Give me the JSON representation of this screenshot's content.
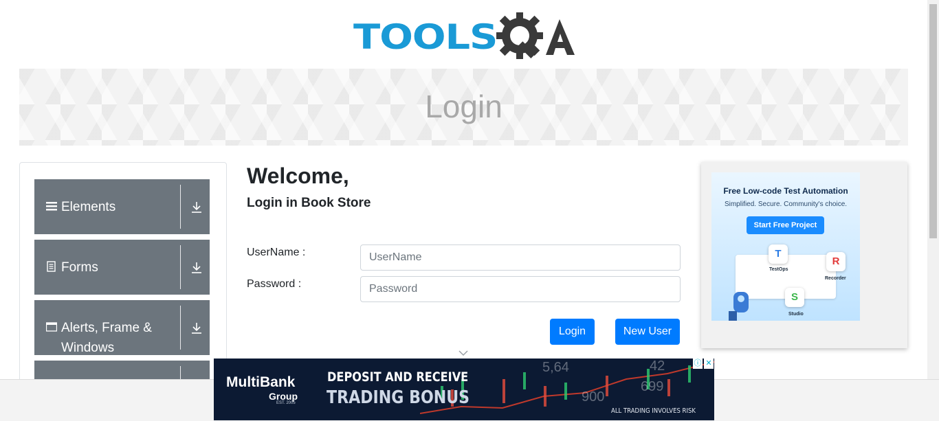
{
  "header": {
    "logo_text": "TOOLSQA",
    "logo_visible_prefix": "TOOLS"
  },
  "banner": {
    "title": "Login"
  },
  "sidebar": {
    "groups": [
      {
        "label": "Elements",
        "icon": "list-icon"
      },
      {
        "label": "Forms",
        "icon": "document-icon"
      },
      {
        "label": "Alerts, Frame & Windows",
        "icon": "window-icon"
      },
      {
        "label": "",
        "icon": ""
      }
    ]
  },
  "main": {
    "welcome": "Welcome,",
    "subtitle": "Login in Book Store",
    "username_label": "UserName :",
    "username_placeholder": "UserName",
    "username_value": "",
    "password_label": "Password :",
    "password_placeholder": "Password",
    "password_value": "",
    "login_button": "Login",
    "new_user_button": "New User"
  },
  "right_ad": {
    "title": "Free Low-code Test Automation",
    "subtitle": "Simplified. Secure. Community's choice.",
    "button": "Start Free Project",
    "products": [
      "TestOps",
      "Recorder",
      "Studio"
    ],
    "accent_color": "#1a8cff"
  },
  "bottom_ad": {
    "brand": "MultiBank",
    "brand_sub": "Group",
    "established": "EST. 2005",
    "headline1": "DEPOSIT AND RECEIVE",
    "headline2": "TRADING BONUS",
    "disclaimer": "ALL TRADING INVOLVES RISK",
    "numbers": [
      "5,64",
      "42",
      "699",
      "900"
    ],
    "info_glyph": "ⓘ",
    "close_glyph": "✕"
  },
  "colors": {
    "brand_blue": "#1a9ad6",
    "sidebar_gray": "#6c757d",
    "primary_button": "#007bff"
  }
}
